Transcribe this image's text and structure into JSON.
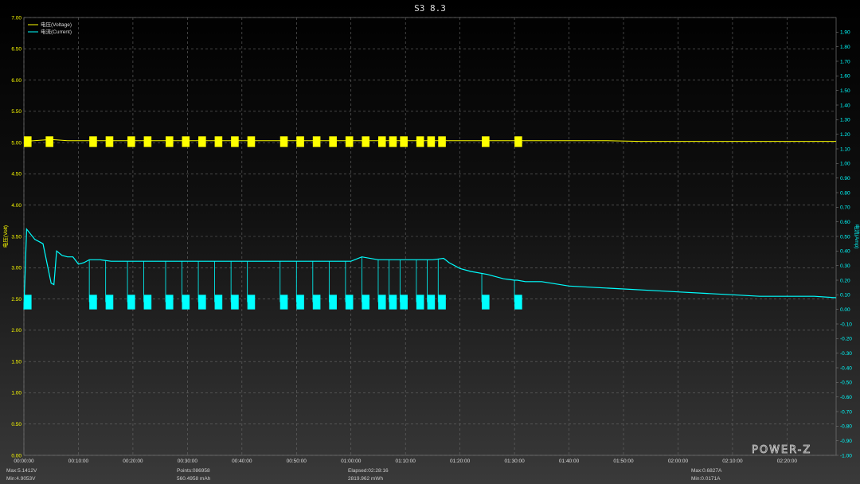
{
  "chart_data": {
    "type": "line",
    "title": "S3 8.3",
    "ylabel_left": "电压(Volt)",
    "ylabel_right": "电流(Amp)",
    "y_left_range": [
      0,
      7
    ],
    "y_left_ticks": [
      "0.00",
      "0.50",
      "1.00",
      "1.50",
      "2.00",
      "2.50",
      "3.00",
      "3.50",
      "4.00",
      "4.50",
      "5.00",
      "5.50",
      "6.00",
      "6.50",
      "7.00"
    ],
    "y_right_range": [
      -1.0,
      2.0
    ],
    "y_right_ticks": [
      "-1.00",
      "-0.90",
      "-0.80",
      "-0.70",
      "-0.60",
      "-0.50",
      "-0.40",
      "-0.30",
      "-0.20",
      "-0.10",
      "0.00",
      "0.10",
      "0.20",
      "0.30",
      "0.40",
      "0.50",
      "0.60",
      "0.70",
      "0.80",
      "0.90",
      "1.00",
      "1.10",
      "1.20",
      "1.30",
      "1.40",
      "1.50",
      "1.60",
      "1.70",
      "1.80",
      "1.90"
    ],
    "x_range_min": [
      0,
      149
    ],
    "x_ticks": [
      "00:00:00",
      "00:10:00",
      "00:20:00",
      "00:30:00",
      "00:40:00",
      "00:50:00",
      "01:00:00",
      "01:10:00",
      "01:20:00",
      "01:30:00",
      "01:40:00",
      "01:50:00",
      "02:00:00",
      "02:10:00",
      "02:20:00"
    ],
    "grid": true,
    "legend_position": "top-left",
    "series": [
      {
        "name": "电压(Voltage)",
        "axis": "left",
        "color": "#ffff00",
        "baseline": 5.03,
        "x_min": [
          0,
          5,
          8,
          13,
          16,
          21,
          25,
          33,
          40,
          50,
          60,
          65,
          70,
          72,
          78,
          83,
          88,
          90,
          100,
          107,
          113,
          120,
          130,
          140,
          149
        ],
        "y": [
          5.02,
          5.05,
          5.03,
          5.03,
          5.03,
          5.03,
          5.03,
          5.03,
          5.03,
          5.03,
          5.03,
          5.03,
          5.03,
          5.03,
          5.03,
          5.03,
          5.03,
          5.03,
          5.03,
          5.03,
          5.02,
          5.02,
          5.02,
          5.02,
          5.02
        ],
        "burst_start_min": [
          0,
          4,
          12,
          15,
          19,
          22,
          26,
          29,
          32,
          35,
          38,
          41,
          47,
          50,
          53,
          56,
          59,
          62,
          65,
          67,
          69,
          72,
          74,
          76,
          84,
          90
        ],
        "burst_band": [
          4.93,
          5.1
        ]
      },
      {
        "name": "电流(Current)",
        "axis": "right",
        "color": "#00ffff",
        "x_min": [
          0,
          0.5,
          2,
          3.5,
          5,
          5.5,
          6,
          7,
          8,
          9,
          10,
          11,
          12,
          14,
          16,
          20,
          25,
          30,
          35,
          40,
          45,
          50,
          55,
          60,
          62,
          65,
          70,
          75,
          77,
          78,
          80,
          82,
          85,
          88,
          90,
          90.5,
          92,
          95,
          100,
          105,
          110,
          115,
          120,
          125,
          130,
          135,
          140,
          145,
          149
        ],
        "y": [
          0.0,
          0.55,
          0.48,
          0.45,
          0.18,
          0.17,
          0.4,
          0.37,
          0.36,
          0.36,
          0.31,
          0.32,
          0.34,
          0.34,
          0.33,
          0.33,
          0.33,
          0.33,
          0.33,
          0.33,
          0.33,
          0.33,
          0.33,
          0.33,
          0.36,
          0.34,
          0.34,
          0.34,
          0.35,
          0.32,
          0.28,
          0.26,
          0.24,
          0.21,
          0.2,
          0.2,
          0.19,
          0.19,
          0.16,
          0.15,
          0.14,
          0.13,
          0.12,
          0.11,
          0.1,
          0.09,
          0.09,
          0.09,
          0.08
        ],
        "drop_start_min": [
          0,
          12,
          15,
          19,
          22,
          26,
          29,
          32,
          35,
          38,
          41,
          47,
          50,
          53,
          56,
          59,
          62,
          65,
          67,
          69,
          72,
          74,
          76,
          84,
          90
        ],
        "drop_value": 0.05
      }
    ]
  },
  "stats": {
    "max_voltage": "Max:5.1412V",
    "min_voltage": "Min:4.9053V",
    "points": "Points:086958",
    "capacity": "560.4958 mAh",
    "elapsed": "Elapsed:02:28:16",
    "energy": "2819.962 mWh",
    "max_current": "Max:0.6827A",
    "min_current": "Min:0.0171A"
  },
  "logo": "POWER-Z",
  "colors": {
    "voltage": "#ffff00",
    "current": "#00ffff",
    "grid": "#6a6a6a"
  }
}
